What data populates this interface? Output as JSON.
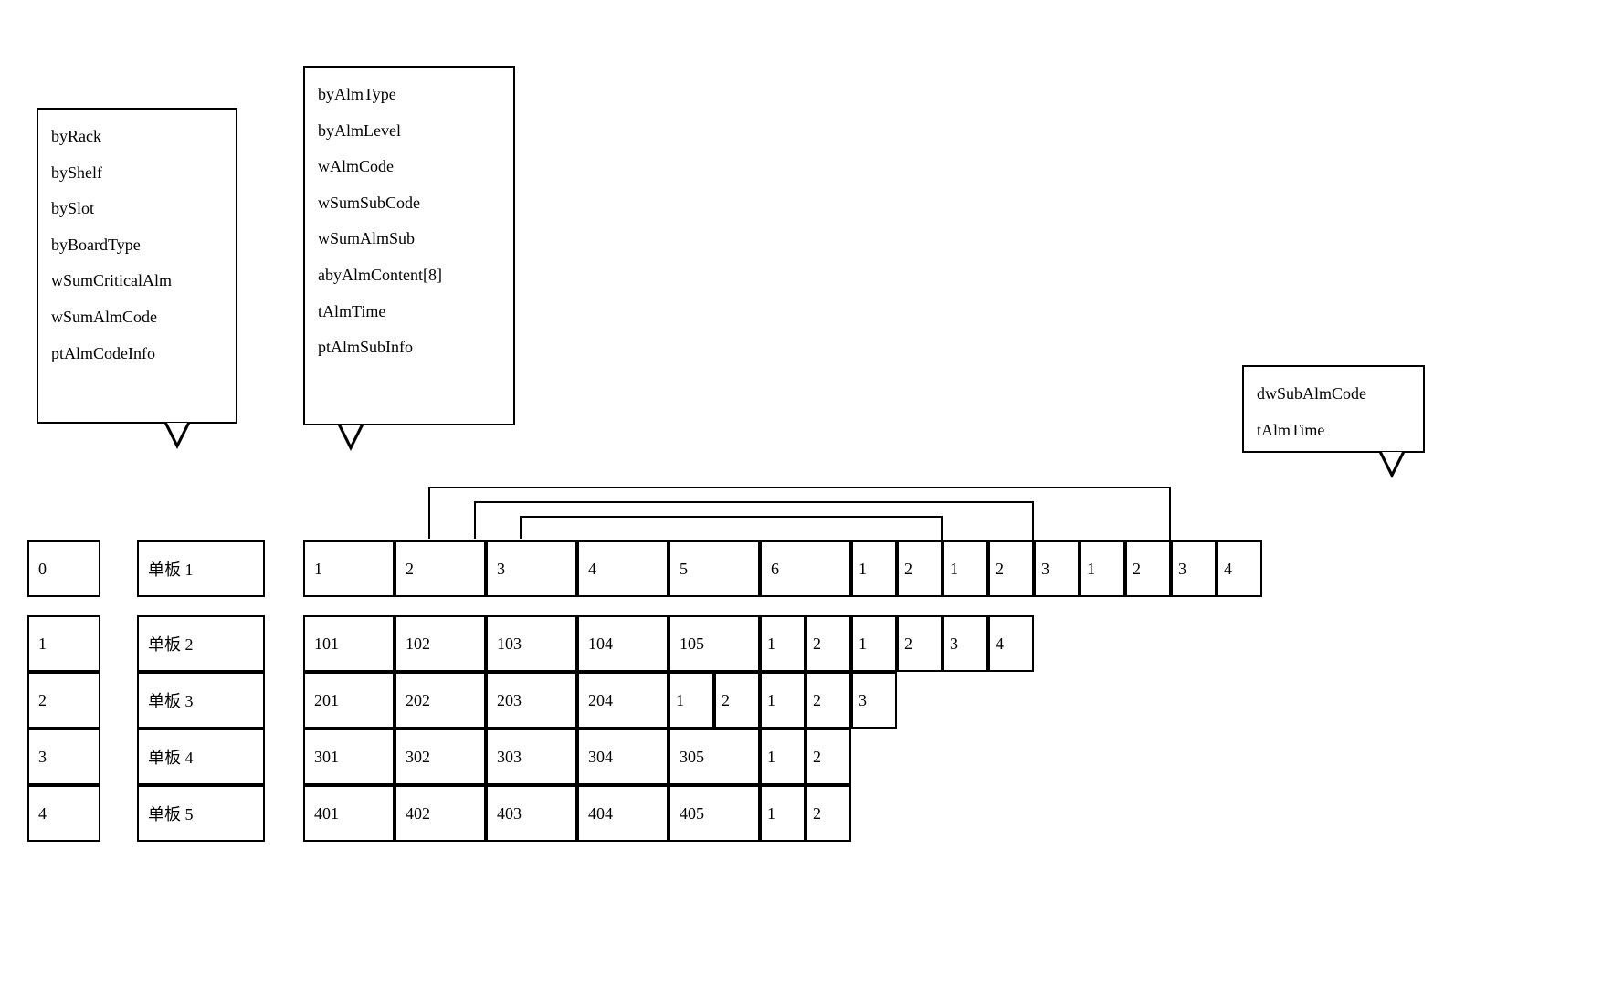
{
  "box_left": {
    "fields": [
      "byRack",
      "byShelf",
      "bySlot",
      "byBoardType",
      "wSumCriticalAlm",
      "wSumAlmCode",
      "ptAlmCodeInfo"
    ]
  },
  "box_mid": {
    "fields": [
      "byAlmType",
      "byAlmLevel",
      "wAlmCode",
      "wSumSubCode",
      "wSumAlmSub",
      "abyAlmContent[8]",
      "tAlmTime",
      "ptAlmSubInfo"
    ]
  },
  "box_right": {
    "fields": [
      "dwSubAlmCode",
      "tAlmTime"
    ]
  },
  "index_col": [
    "0",
    "1",
    "2",
    "3",
    "4"
  ],
  "board_col": [
    "单板 1",
    "单板 2",
    "单板 3",
    "单板 4",
    "单板 5"
  ],
  "rows": [
    {
      "wide": [
        "1",
        "2",
        "3",
        "4",
        "5",
        "6"
      ],
      "small": [
        "1",
        "2",
        "1",
        "2",
        "3",
        "1",
        "2",
        "3",
        "4"
      ]
    },
    {
      "wide": [
        "101",
        "102",
        "103",
        "104",
        "105"
      ],
      "small": [
        "1",
        "2",
        "1",
        "2",
        "3",
        "4"
      ]
    },
    {
      "wide": [
        "201",
        "202",
        "203",
        "204"
      ],
      "small": [
        "1",
        "2",
        "1",
        "2",
        "3"
      ]
    },
    {
      "wide": [
        "301",
        "302",
        "303",
        "304",
        "305"
      ],
      "small": [
        "1",
        "2"
      ]
    },
    {
      "wide": [
        "401",
        "402",
        "403",
        "404",
        "405"
      ],
      "small": [
        "1",
        "2"
      ]
    }
  ]
}
